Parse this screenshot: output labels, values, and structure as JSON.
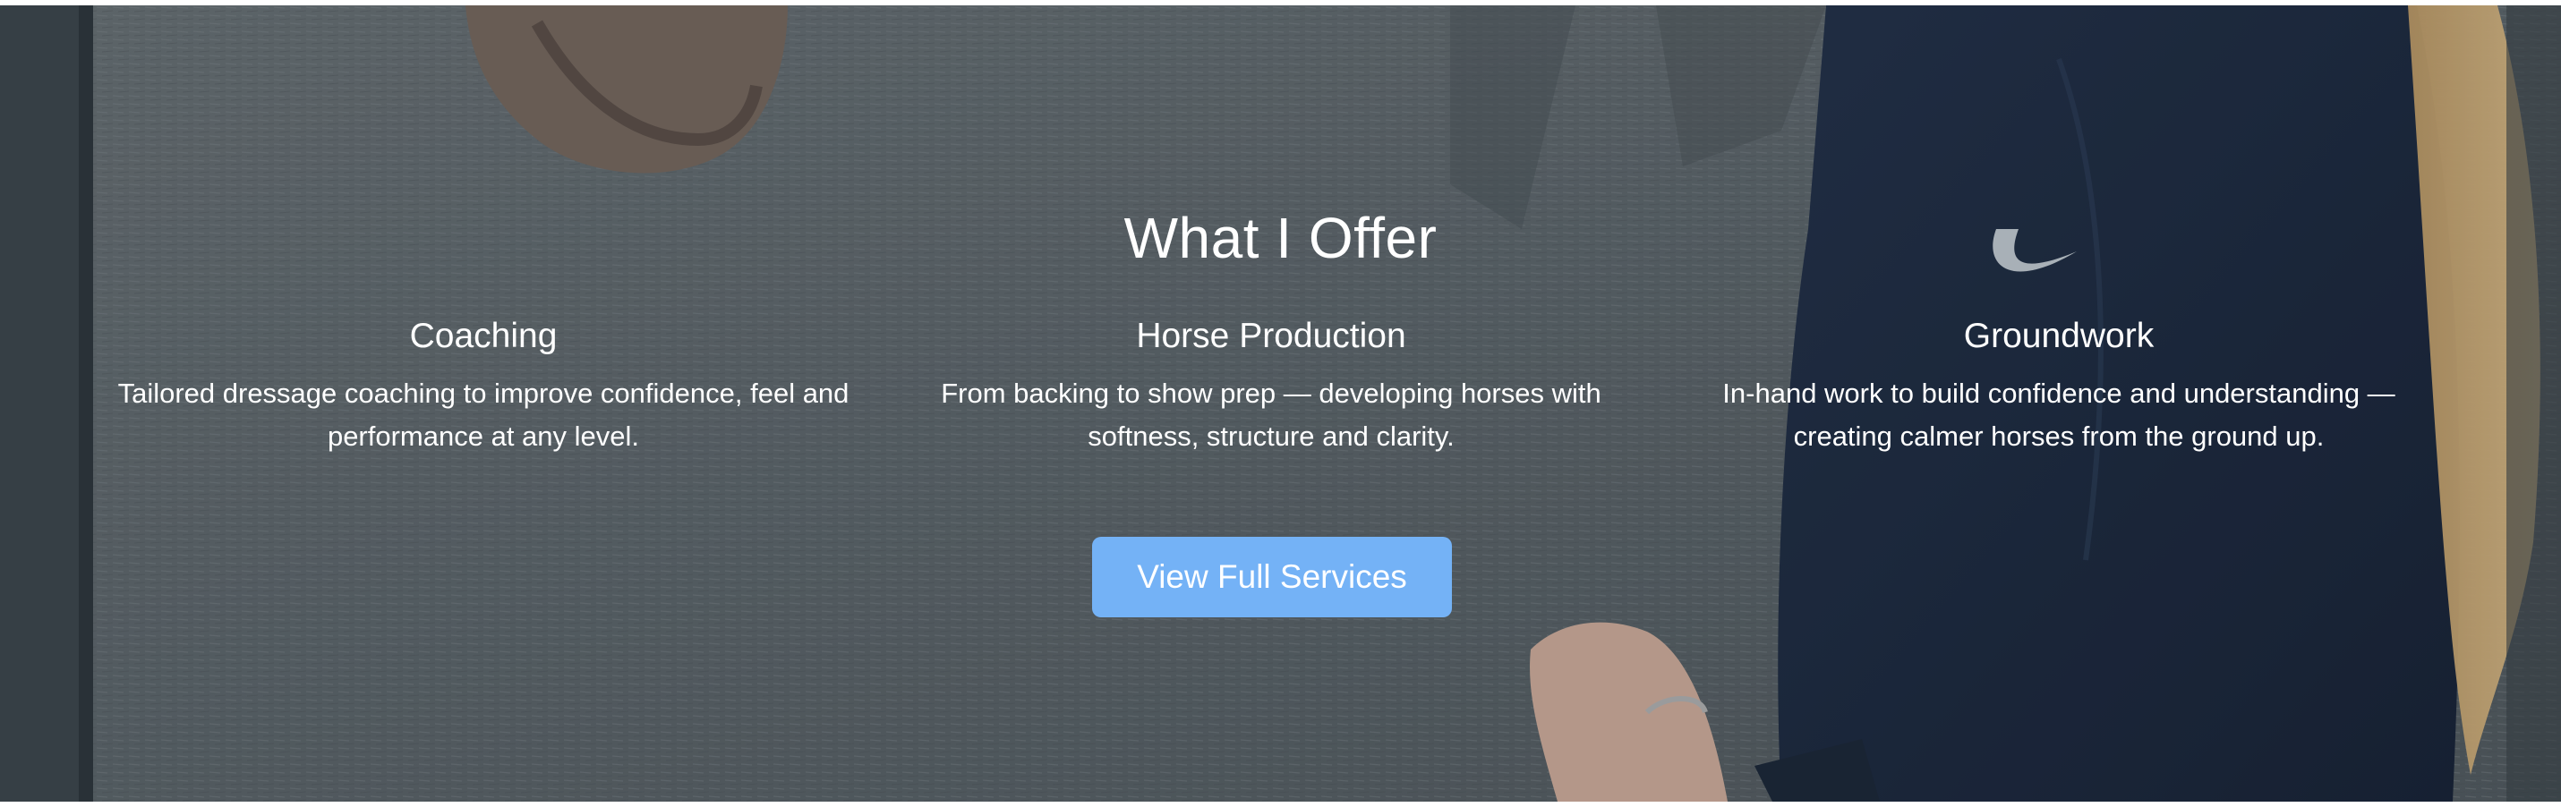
{
  "section": {
    "heading": "What I Offer",
    "services": [
      {
        "title": "Coaching",
        "description": "Tailored dressage coaching to improve confidence, feel and performance at any level."
      },
      {
        "title": "Horse Production",
        "description": "From backing to show prep — developing horses with softness, structure and clarity."
      },
      {
        "title": "Groundwork",
        "description": "In-hand work to build confidence and understanding — creating calmer horses from the ground up."
      }
    ],
    "cta_label": "View Full Services"
  },
  "colors": {
    "button": "#74b2f6",
    "text": "#ffffff",
    "background_wall": "#626b70",
    "jacket": "#1d2a3d"
  }
}
